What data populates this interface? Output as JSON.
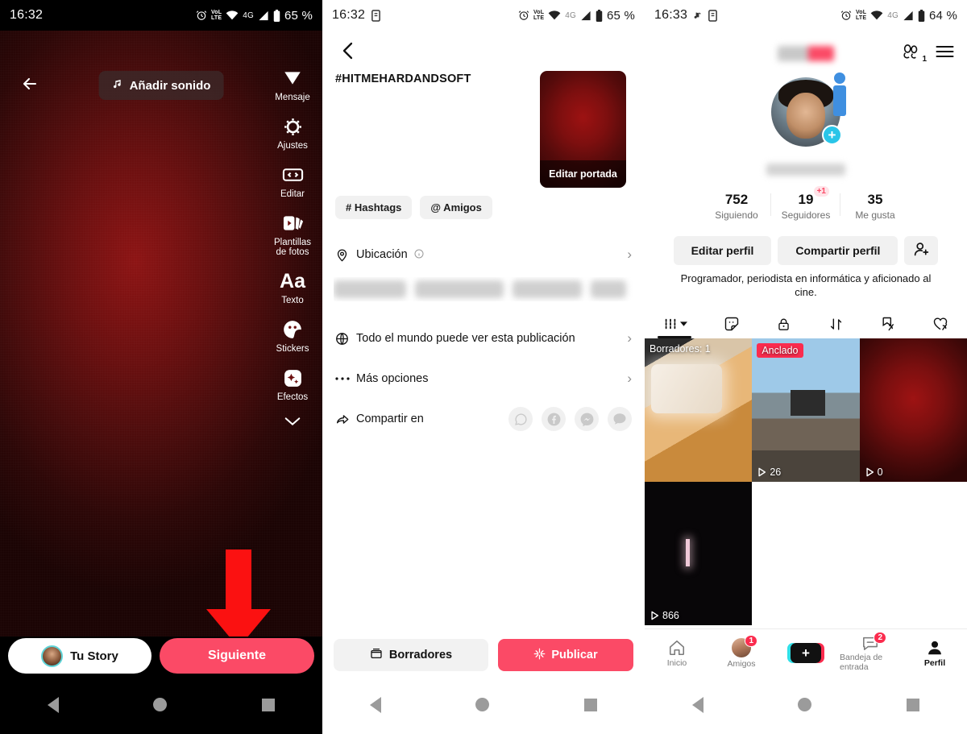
{
  "panel1": {
    "status": {
      "time": "16:32",
      "battery": "65 %",
      "network": "4G",
      "carrier": "VoLTE"
    },
    "back_label": "back-arrow",
    "add_sound": "Añadir sonido",
    "tools": [
      {
        "label": "Mensaje",
        "icon": "send-icon"
      },
      {
        "label": "Ajustes",
        "icon": "gear-icon"
      },
      {
        "label": "Editar",
        "icon": "trim-icon"
      },
      {
        "label": "Plantillas\nde fotos",
        "line1": "Plantillas",
        "line2": "de fotos",
        "icon": "photo-templates-icon"
      },
      {
        "label": "Texto",
        "icon": "text-aa-icon"
      },
      {
        "label": "Stickers",
        "icon": "sticker-icon"
      },
      {
        "label": "Efectos",
        "icon": "effects-icon"
      }
    ],
    "story_button": "Tu Story",
    "next_button": "Siguiente"
  },
  "panel2": {
    "status": {
      "time": "16:32",
      "battery": "65 %",
      "network": "4G",
      "carrier": "VoLTE"
    },
    "caption": "#HITMEHARDANDSOFT",
    "cover_label": "Editar portada",
    "chips": [
      "# Hashtags",
      "@ Amigos"
    ],
    "rows": [
      {
        "label": "Ubicación",
        "icon": "location-pin-icon",
        "info": true
      },
      {
        "label": "Todo el mundo puede ver esta publicación",
        "icon": "globe-icon",
        "info": false
      },
      {
        "label": "Más opciones",
        "icon": "ellipsis-icon",
        "info": false
      },
      {
        "label": "Compartir en",
        "icon": "share-arrow-icon",
        "info": false
      }
    ],
    "share_targets": [
      "whatsapp-icon",
      "facebook-icon",
      "messenger-icon",
      "sms-icon"
    ],
    "drafts_button": "Borradores",
    "publish_button": "Publicar"
  },
  "panel3": {
    "status": {
      "time": "16:33",
      "battery": "64 %",
      "network": "4G",
      "carrier": "VoLTE"
    },
    "header_icons": [
      "friend-requests-icon",
      "hamburger-menu-icon"
    ],
    "friend_request_count": "1",
    "stats": [
      {
        "num": "752",
        "label": "Siguiendo",
        "badge": ""
      },
      {
        "num": "19",
        "label": "Seguidores",
        "badge": "+1"
      },
      {
        "num": "35",
        "label": "Me gusta",
        "badge": ""
      }
    ],
    "actions": [
      "Editar perfil",
      "Compartir perfil"
    ],
    "add_friend_icon": "add-person-icon",
    "bio": "Programador, periodista en informática y aficionado al cine.",
    "tabs": [
      {
        "icon": "grid-posts-icon",
        "caret": true
      },
      {
        "icon": "sticker-face-icon",
        "caret": false
      },
      {
        "icon": "lock-private-icon",
        "caret": false
      },
      {
        "icon": "repost-icon",
        "caret": false
      },
      {
        "icon": "hidden-bookmark-icon",
        "caret": false
      },
      {
        "icon": "hidden-likes-icon",
        "caret": false
      }
    ],
    "grid": [
      {
        "tag": "Borradores: 1",
        "pinned": false,
        "views": "",
        "thumb": "thumb-food"
      },
      {
        "tag": "Anclado",
        "pinned": true,
        "views": "26",
        "thumb": "thumb-concert"
      },
      {
        "tag": "",
        "pinned": false,
        "views": "0",
        "thumb": "thumb-red"
      },
      {
        "tag": "",
        "pinned": false,
        "views": "866",
        "thumb": "thumb-night"
      }
    ],
    "nav": [
      {
        "label": "Inicio",
        "icon": "home-icon",
        "badge": "",
        "active": false
      },
      {
        "label": "Amigos",
        "icon": "friends-avatar-icon",
        "badge": "1",
        "active": false
      },
      {
        "label": "",
        "icon": "create-plus-icon",
        "badge": "",
        "active": false
      },
      {
        "label": "Bandeja de entrada",
        "icon": "inbox-icon",
        "badge": "2",
        "active": false
      },
      {
        "label": "Perfil",
        "icon": "profile-person-icon",
        "badge": "",
        "active": true
      }
    ]
  },
  "colors": {
    "accent_pink": "#fb4a66",
    "pin_red": "#fb2c4e",
    "arrow_red": "#fb1111",
    "cyan": "#29c5e8"
  }
}
